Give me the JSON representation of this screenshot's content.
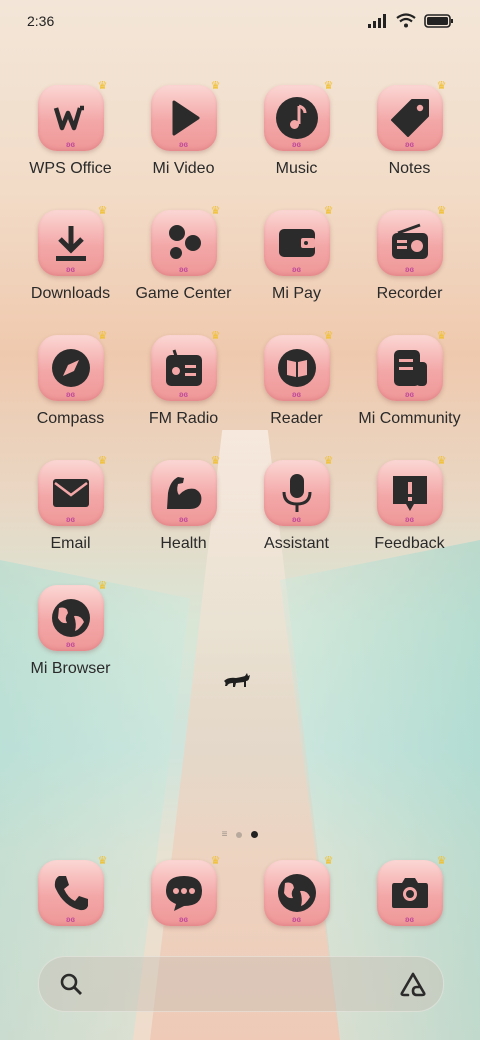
{
  "status_bar": {
    "time": "2:36"
  },
  "apps": [
    {
      "label": "WPS Office",
      "icon": "wps-office-icon"
    },
    {
      "label": "Mi Video",
      "icon": "play-icon"
    },
    {
      "label": "Music",
      "icon": "music-note-icon"
    },
    {
      "label": "Notes",
      "icon": "tag-icon"
    },
    {
      "label": "Downloads",
      "icon": "download-icon"
    },
    {
      "label": "Game Center",
      "icon": "game-dots-icon"
    },
    {
      "label": "Mi Pay",
      "icon": "wallet-icon"
    },
    {
      "label": "Recorder",
      "icon": "radio-recorder-icon"
    },
    {
      "label": "Compass",
      "icon": "compass-icon"
    },
    {
      "label": "FM Radio",
      "icon": "fm-radio-icon"
    },
    {
      "label": "Reader",
      "icon": "book-icon"
    },
    {
      "label": "Mi Community",
      "icon": "community-icon"
    },
    {
      "label": "Email",
      "icon": "envelope-icon"
    },
    {
      "label": "Health",
      "icon": "muscle-arm-icon"
    },
    {
      "label": "Assistant",
      "icon": "microphone-icon"
    },
    {
      "label": "Feedback",
      "icon": "exclamation-bubble-icon"
    },
    {
      "label": "Mi Browser",
      "icon": "globe-icon"
    }
  ],
  "dock": [
    {
      "icon": "phone-icon"
    },
    {
      "icon": "chat-bubble-icon"
    },
    {
      "icon": "globe-icon"
    },
    {
      "icon": "camera-icon"
    }
  ],
  "page_indicator": {
    "pages": 2,
    "active": 2
  },
  "search_bar": {
    "left_icon": "search-icon",
    "right_icon": "assistant-logo-icon"
  },
  "colors": {
    "tile_top": "#fbd7d4",
    "tile_bottom": "#ef9798",
    "glyph": "#2b2b2b"
  }
}
